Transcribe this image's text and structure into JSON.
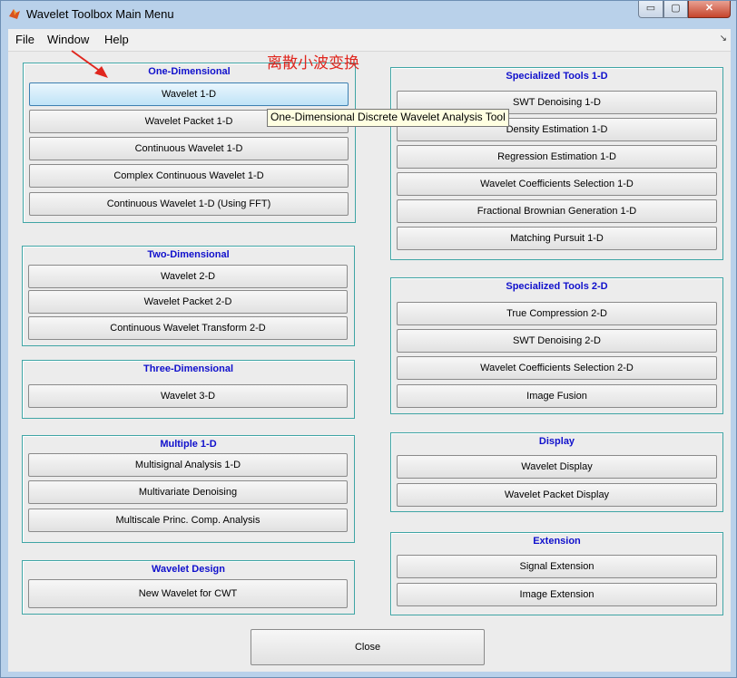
{
  "window": {
    "title": "Wavelet Toolbox Main Menu",
    "buttons": {
      "minimize": "▭",
      "maximize": "▢",
      "close": "✕"
    }
  },
  "menubar": {
    "items": [
      "File",
      "Window",
      "Help"
    ],
    "dock": "↘"
  },
  "groups": [
    {
      "title": "One-Dimensional",
      "buttons": [
        "Wavelet 1-D",
        "Wavelet Packet 1-D",
        "Continuous Wavelet 1-D",
        "Complex Continuous Wavelet 1-D",
        "Continuous Wavelet 1-D (Using FFT)"
      ]
    },
    {
      "title": "Two-Dimensional",
      "buttons": [
        "Wavelet 2-D",
        "Wavelet Packet 2-D",
        "Continuous Wavelet Transform 2-D"
      ]
    },
    {
      "title": "Three-Dimensional",
      "buttons": [
        "Wavelet 3-D"
      ]
    },
    {
      "title": "Multiple 1-D",
      "buttons": [
        "Multisignal Analysis 1-D",
        "Multivariate Denoising",
        "Multiscale Princ. Comp. Analysis"
      ]
    },
    {
      "title": "Wavelet Design",
      "buttons": [
        "New Wavelet for CWT"
      ]
    },
    {
      "title": "Specialized Tools 1-D",
      "buttons": [
        "SWT Denoising 1-D",
        "Density Estimation 1-D",
        "Regression Estimation 1-D",
        "Wavelet Coefficients Selection 1-D",
        "Fractional Brownian Generation 1-D",
        "Matching Pursuit 1-D"
      ]
    },
    {
      "title": "Specialized Tools 2-D",
      "buttons": [
        "True Compression 2-D",
        "SWT Denoising 2-D",
        "Wavelet Coefficients Selection 2-D",
        "Image Fusion"
      ]
    },
    {
      "title": "Display",
      "buttons": [
        "Wavelet Display",
        "Wavelet Packet Display"
      ]
    },
    {
      "title": "Extension",
      "buttons": [
        "Signal Extension",
        "Image Extension"
      ]
    }
  ],
  "close_button": "Close",
  "tooltip": "One-Dimensional Discrete Wavelet Analysis Tool",
  "annotation": "离散小波变换",
  "colors": {
    "group_title": "#1010cc",
    "group_border": "#3fa5a5",
    "annotation": "#e0261e",
    "hover_button": "#bfe3f7"
  },
  "hovered_button": "Wavelet 1-D"
}
